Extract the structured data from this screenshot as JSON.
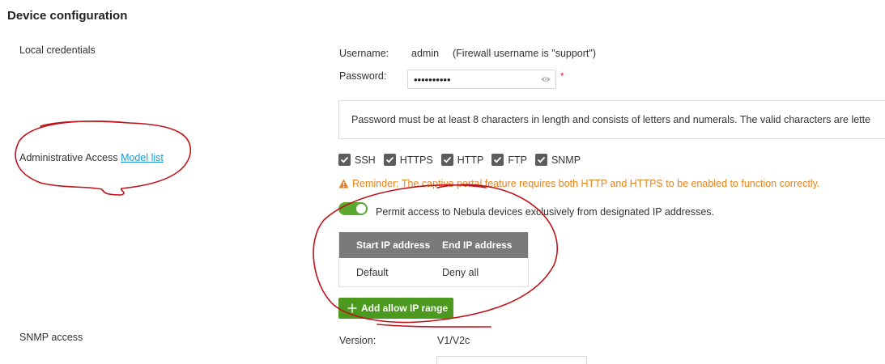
{
  "page": {
    "title": "Device configuration"
  },
  "local_credentials": {
    "section_label": "Local credentials",
    "username_label": "Username:",
    "username_value": "admin",
    "username_note": "(Firewall username is \"support\")",
    "password_label": "Password:",
    "password_masked": "••••••••••",
    "required_mark": "*",
    "info_text": "Password must be at least 8 characters in length and consists of letters and numerals. The valid characters are lette"
  },
  "admin_access": {
    "label": "Administrative Access",
    "link": "Model list",
    "protocols": [
      {
        "label": "SSH",
        "checked": true
      },
      {
        "label": "HTTPS",
        "checked": true
      },
      {
        "label": "HTTP",
        "checked": true
      },
      {
        "label": "FTP",
        "checked": true
      },
      {
        "label": "SNMP",
        "checked": true
      }
    ],
    "reminder": "Reminder: The captive portal feature requires both HTTP and HTTPS to be enabled to function correctly.",
    "toggle_on": true,
    "toggle_label": "Permit access to Nebula devices exclusively from designated IP addresses.",
    "table": {
      "headers": [
        "Start IP address",
        "End IP address"
      ],
      "rows": [
        [
          "Default",
          "Deny all"
        ]
      ]
    },
    "add_button": "Add allow IP range"
  },
  "snmp": {
    "section_label": "SNMP access",
    "version_label": "Version:",
    "version_value": "V1/V2c"
  },
  "colors": {
    "accent_green": "#4b9a1f",
    "toggle_green": "#5aa82d",
    "warning_orange": "#e8821a",
    "link_blue": "#1a9ad6",
    "table_header": "#7a7a7a",
    "annotation_red": "#c0121a"
  },
  "icons": [
    "eye-icon",
    "checkbox-check-icon",
    "warning-icon",
    "plus-icon"
  ]
}
